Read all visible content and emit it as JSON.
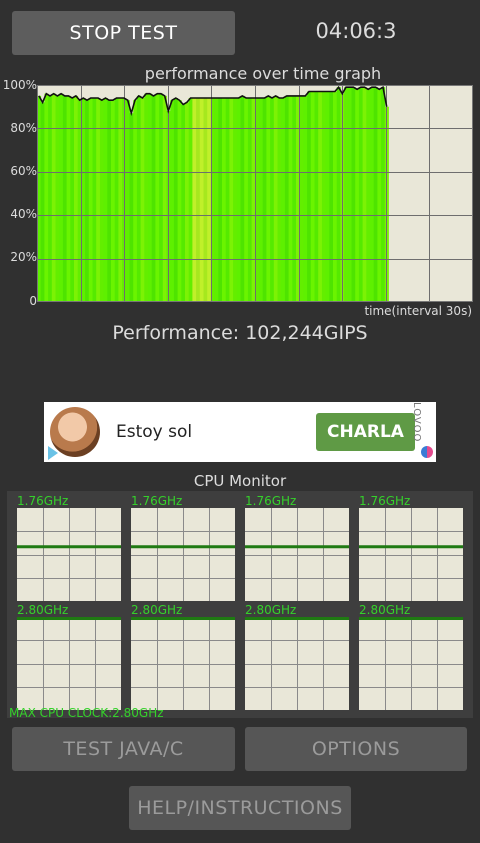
{
  "header": {
    "stop_button": "STOP TEST",
    "timer": "04:06:3"
  },
  "graph": {
    "title": "performance over time graph",
    "y_labels": [
      "100%",
      "80%",
      "60%",
      "40%",
      "20%",
      "0"
    ],
    "x_label": "time(interval 30s)"
  },
  "chart_data": {
    "type": "area",
    "title": "performance over time graph",
    "xlabel": "time(interval 30s)",
    "ylabel": "",
    "ylim": [
      0,
      100
    ],
    "grid": true,
    "series": [
      {
        "values": [
          95,
          92,
          96,
          95,
          96,
          95,
          96,
          95,
          95,
          94,
          95,
          93,
          94,
          93,
          94,
          94,
          94,
          93,
          94,
          93,
          93,
          94,
          94,
          94,
          93,
          87,
          93,
          95,
          94,
          96,
          96,
          95,
          96,
          96,
          95,
          88,
          93,
          94,
          93,
          91,
          92,
          94,
          94,
          94,
          94,
          94,
          94,
          94,
          94,
          94,
          94,
          94,
          94,
          94,
          94,
          95,
          94,
          94,
          94,
          94,
          94,
          94,
          95,
          94,
          95,
          94,
          94,
          95,
          95,
          95,
          95,
          95,
          95,
          97,
          97,
          97,
          97,
          97,
          97,
          97,
          97,
          99,
          96,
          99,
          99,
          99,
          98,
          99,
          99,
          98,
          99,
          99,
          98,
          99,
          90
        ]
      }
    ]
  },
  "performance": {
    "text": "Performance: 102,244GIPS"
  },
  "ad": {
    "text": "Estoy sol",
    "cta": "CHARLA",
    "brand": "LOVOO"
  },
  "cpu": {
    "title": "CPU Monitor",
    "cores": [
      {
        "freq": "1.76GHz",
        "level": 0.6
      },
      {
        "freq": "1.76GHz",
        "level": 0.6
      },
      {
        "freq": "1.76GHz",
        "level": 0.6
      },
      {
        "freq": "1.76GHz",
        "level": 0.6
      },
      {
        "freq": "2.80GHz",
        "level": 1.0
      },
      {
        "freq": "2.80GHz",
        "level": 1.0
      },
      {
        "freq": "2.80GHz",
        "level": 1.0
      },
      {
        "freq": "2.80GHz",
        "level": 1.0
      }
    ],
    "max_clock": "MAX CPU CLOCK:2.80GHz"
  },
  "buttons": {
    "test_java": "TEST JAVA/C",
    "options": "OPTIONS",
    "help": "HELP/INSTRUCTIONS"
  },
  "colors": {
    "background": "#303030",
    "bar_green": "#5ef000",
    "cpu_label_green": "#35d12b",
    "cta_green": "#5f9a45"
  }
}
